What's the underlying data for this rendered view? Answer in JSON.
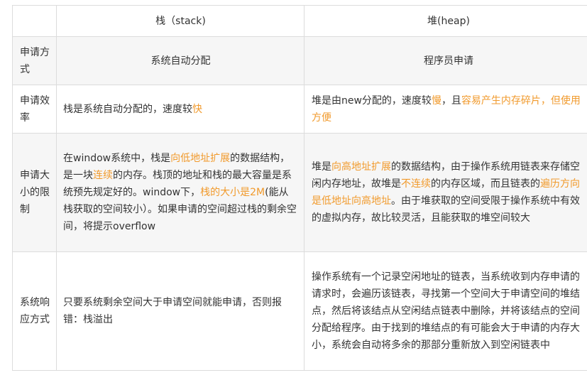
{
  "header": {
    "col0": "",
    "col1": "栈（stack)",
    "col2": "堆(heap)"
  },
  "rows": [
    {
      "label": "申请方式",
      "stack": [
        {
          "t": "系统自动分配",
          "h": false
        }
      ],
      "heap": [
        {
          "t": "程序员申请",
          "h": false
        }
      ]
    },
    {
      "label": "申请效率",
      "stack": [
        {
          "t": "栈是系统自动分配的，速度较",
          "h": false
        },
        {
          "t": "快",
          "h": true
        }
      ],
      "heap": [
        {
          "t": "堆是由new分配的，速度较",
          "h": false
        },
        {
          "t": "慢",
          "h": true
        },
        {
          "t": "，且",
          "h": false
        },
        {
          "t": "容易产生内存碎片，但使用方便",
          "h": true
        }
      ]
    },
    {
      "label": "申请大小的限制",
      "stack": [
        {
          "t": "在window系统中，栈是",
          "h": false
        },
        {
          "t": "向低地址扩展",
          "h": true
        },
        {
          "t": "的数据结构，是一块",
          "h": false
        },
        {
          "t": "连续",
          "h": true
        },
        {
          "t": "的内存。栈顶的地址和栈的最大容量是系统预先规定好的。window下，",
          "h": false
        },
        {
          "t": "栈的大小是2M",
          "h": true
        },
        {
          "t": "(能从栈获取的空间较小）。如果申请的空间超过栈的剩余空间，将提示overflow",
          "h": false
        }
      ],
      "heap": [
        {
          "t": "堆是",
          "h": false
        },
        {
          "t": "向高地址扩展",
          "h": true
        },
        {
          "t": "的数据结构，由于操作系统用链表来存储空闲内存地址，故堆是",
          "h": false
        },
        {
          "t": "不连续",
          "h": true
        },
        {
          "t": "的内存区域，而且链表的",
          "h": false
        },
        {
          "t": "遍历方向是低地址向高地址",
          "h": true
        },
        {
          "t": "。由于堆获取的空间受限于操作系统中有效的虚拟内存，故比较灵活，且能获取的堆空间较大",
          "h": false
        }
      ]
    },
    {
      "label": "系统响应方式",
      "stack": [
        {
          "t": "只要系统剩余空间大于申请空间就能申请，否则报错：栈溢出",
          "h": false
        }
      ],
      "heap": [
        {
          "t": "操作系统有一个记录空闲地址的链表，当系统收到内存申请的请求时，会遍历该链表，寻找第一个空间大于申请空间的堆结点，然后将该结点从空闲结点链表中删除，并将该结点的空间分配给程序。由于找到的堆结点的有可能会大于申请的内存大小，系统会自动将多余的那部分重新放入到空闲链表中",
          "h": false
        }
      ]
    }
  ],
  "colors": {
    "highlight": "#f19a2c",
    "text": "#333333",
    "border": "#dcdcdc",
    "zebra": "#f6f6f6"
  }
}
